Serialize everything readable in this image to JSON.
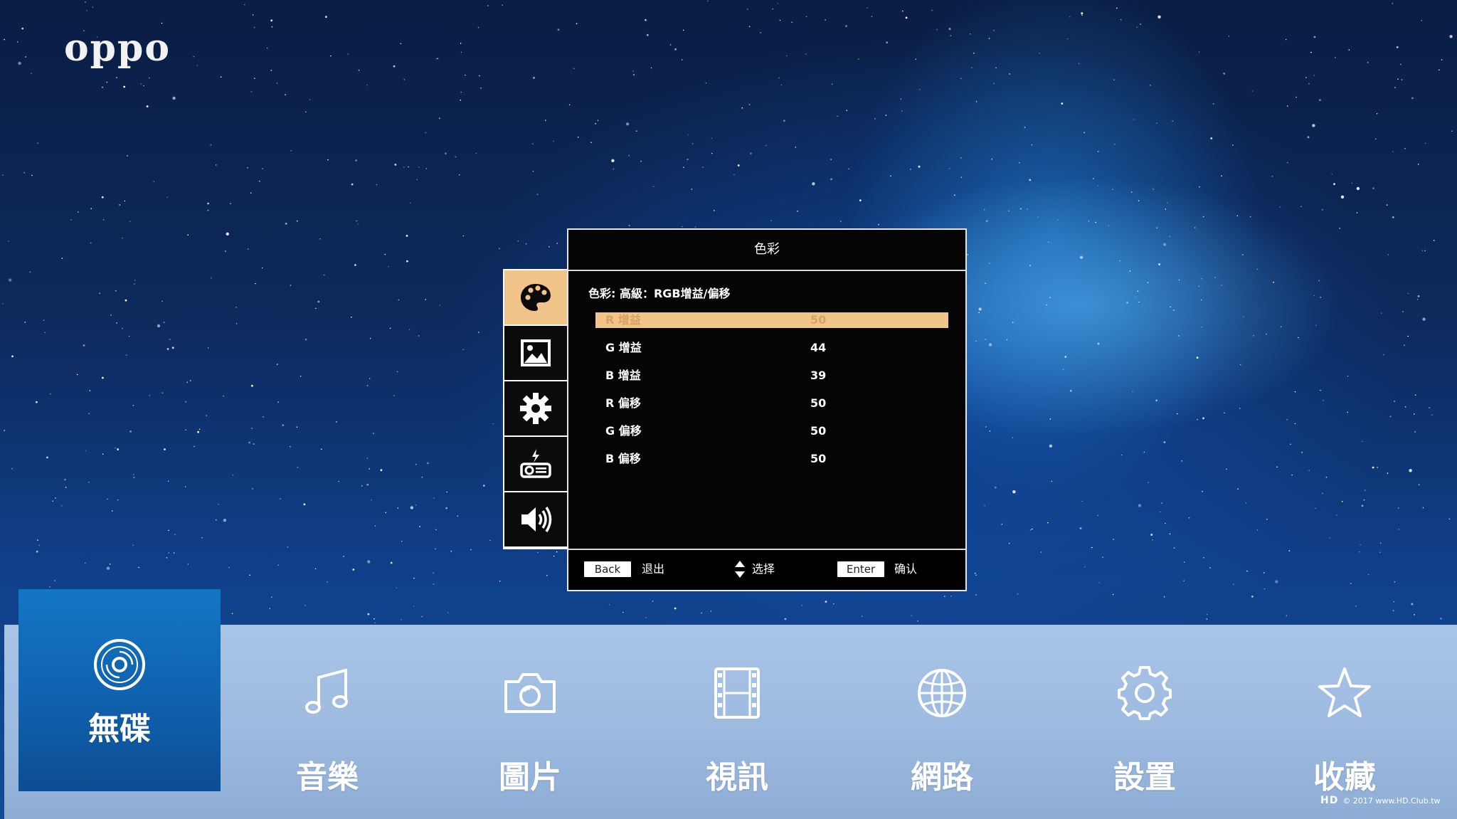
{
  "brand": "oppo",
  "osd": {
    "title": "色彩",
    "breadcrumb": "色彩: 高級：RGB增益/偏移",
    "rows": [
      {
        "label": "R 增益",
        "value": "50"
      },
      {
        "label": "G 增益",
        "value": "44"
      },
      {
        "label": "B 增益",
        "value": "39"
      },
      {
        "label": "R 偏移",
        "value": "50"
      },
      {
        "label": "G 偏移",
        "value": "50"
      },
      {
        "label": "B 偏移",
        "value": "50"
      }
    ],
    "tabs": [
      {
        "icon": "palette-icon"
      },
      {
        "icon": "picture-icon"
      },
      {
        "icon": "gear-icon"
      },
      {
        "icon": "projector-icon"
      },
      {
        "icon": "speaker-icon"
      }
    ],
    "footer": {
      "back_key": "Back",
      "back_hint": "退出",
      "select_hint": "选择",
      "enter_key": "Enter",
      "enter_hint": "确认"
    }
  },
  "menu": [
    {
      "label": "無碟",
      "icon": "disc-icon"
    },
    {
      "label": "音樂",
      "icon": "music-note-icon"
    },
    {
      "label": "圖片",
      "icon": "camera-icon"
    },
    {
      "label": "視訊",
      "icon": "film-icon"
    },
    {
      "label": "網路",
      "icon": "globe-icon"
    },
    {
      "label": "設置",
      "icon": "gear-icon"
    },
    {
      "label": "收藏",
      "icon": "star-icon"
    }
  ],
  "watermark": {
    "logo": "HD",
    "text": "© 2017 www.HD.Club.tw"
  },
  "colors": {
    "accent": "#f1c48a",
    "menu_active": "#1476c6",
    "menu_bar": "#a9c4e6"
  }
}
